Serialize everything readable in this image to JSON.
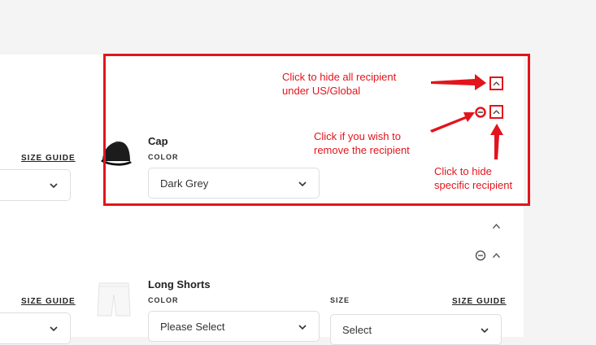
{
  "size_guide_label": "SIZE GUIDE",
  "products": [
    {
      "name": "Cap",
      "color_label": "COLOR",
      "color_value": "Dark Grey",
      "image_icon": "black-cap-icon"
    },
    {
      "name": "Long Shorts",
      "color_label": "COLOR",
      "color_value": "Please Select",
      "size_label": "SIZE",
      "size_value": "Select",
      "image_icon": "white-shorts-icon"
    }
  ],
  "annotations": {
    "hide_all": [
      "Click to hide all recipient",
      "under US/Global"
    ],
    "remove": [
      "Click if you wish to",
      "remove the recipient"
    ],
    "hide_specific": [
      "Click to hide",
      "specific recipient"
    ],
    "color": "#e3141b"
  },
  "icons": {
    "collapse": "chevron-up-icon",
    "remove": "minus-circle-icon",
    "dropdown": "chevron-down-icon"
  }
}
